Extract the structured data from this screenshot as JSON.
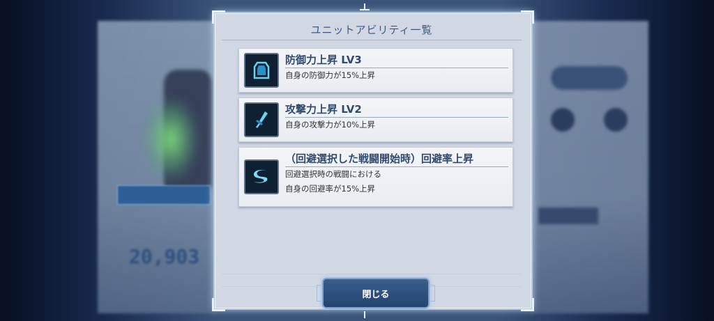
{
  "modal": {
    "title": "ユニットアビリティ一覧",
    "close_label": "閉じる"
  },
  "abilities": [
    {
      "icon": "shield-icon",
      "name": "防御力上昇 LV3",
      "desc": [
        "自身の防御力が15%上昇"
      ]
    },
    {
      "icon": "sword-icon",
      "name": "攻撃力上昇 LV2",
      "desc": [
        "自身の攻撃力が10%上昇"
      ]
    },
    {
      "icon": "evasion-swoosh-icon",
      "name": "（回避選択した戦闘開始時）回避率上昇",
      "desc": [
        "回避選択時の戦闘における",
        "自身の回避率が15%上昇"
      ]
    }
  ],
  "background": {
    "badge_text": "",
    "power_value": "20,903"
  },
  "colors": {
    "accent": "#2f4a70",
    "button": "#23446e"
  }
}
